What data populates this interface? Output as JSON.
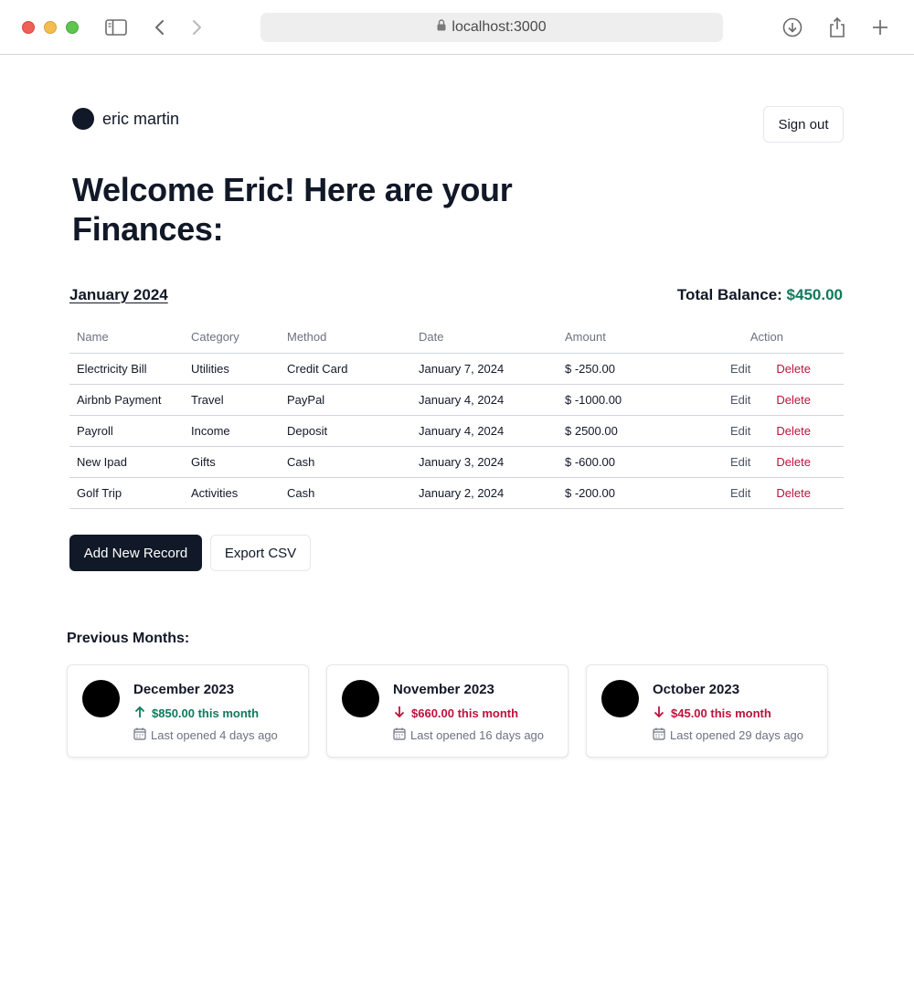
{
  "browser": {
    "url": "localhost:3000"
  },
  "header": {
    "user_name": "eric martin",
    "sign_out_label": "Sign out"
  },
  "welcome_heading": "Welcome Eric! Here are your Finances:",
  "current_month": {
    "title": "January 2024",
    "total_balance_label": "Total Balance:",
    "total_balance_value": "$450.00"
  },
  "table": {
    "headers": {
      "name": "Name",
      "category": "Category",
      "method": "Method",
      "date": "Date",
      "amount": "Amount",
      "action": "Action"
    },
    "rows": [
      {
        "name": "Electricity Bill",
        "category": "Utilities",
        "method": "Credit Card",
        "date": "January 7, 2024",
        "amount": "$ -250.00",
        "edit": "Edit",
        "delete": "Delete"
      },
      {
        "name": "Airbnb Payment",
        "category": "Travel",
        "method": "PayPal",
        "date": "January 4, 2024",
        "amount": "$ -1000.00",
        "edit": "Edit",
        "delete": "Delete"
      },
      {
        "name": "Payroll",
        "category": "Income",
        "method": "Deposit",
        "date": "January 4, 2024",
        "amount": "$ 2500.00",
        "edit": "Edit",
        "delete": "Delete"
      },
      {
        "name": "New Ipad",
        "category": "Gifts",
        "method": "Cash",
        "date": "January 3, 2024",
        "amount": "$ -600.00",
        "edit": "Edit",
        "delete": "Delete"
      },
      {
        "name": "Golf Trip",
        "category": "Activities",
        "method": "Cash",
        "date": "January 2, 2024",
        "amount": "$ -200.00",
        "edit": "Edit",
        "delete": "Delete"
      }
    ]
  },
  "actions": {
    "add_record_label": "Add New Record",
    "export_csv_label": "Export CSV"
  },
  "previous_months": {
    "title": "Previous Months:",
    "cards": [
      {
        "month": "December 2023",
        "change": "$850.00 this month",
        "direction": "up",
        "last_opened": "Last opened 4 days ago"
      },
      {
        "month": "November 2023",
        "change": "$660.00 this month",
        "direction": "down",
        "last_opened": "Last opened 16 days ago"
      },
      {
        "month": "October 2023",
        "change": "$45.00 this month",
        "direction": "down",
        "last_opened": "Last opened 29 days ago"
      }
    ]
  },
  "colors": {
    "positive": "#0f7a5c",
    "negative": "#be123c",
    "primary": "#111827"
  }
}
